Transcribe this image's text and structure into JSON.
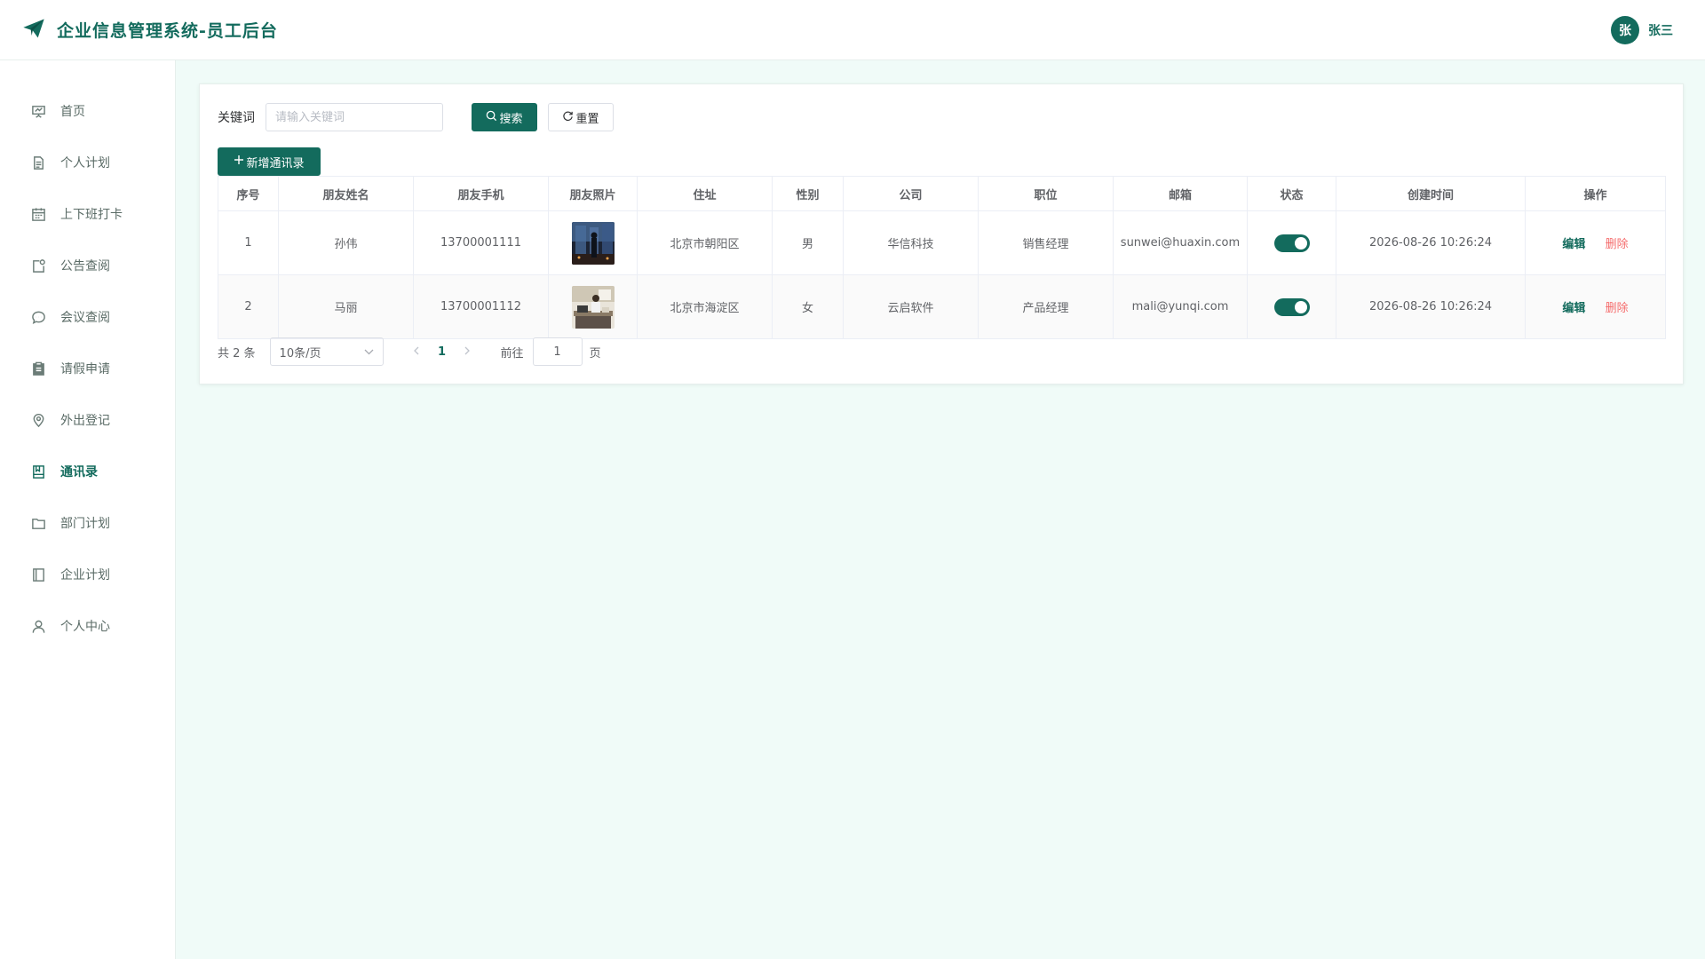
{
  "header": {
    "title": "企业信息管理系统-员工后台",
    "logo_icon": "paper-plane-icon"
  },
  "user": {
    "avatar_text": "张",
    "name": "张三"
  },
  "sidebar": {
    "items": [
      {
        "label": "首页",
        "icon": "presentation-icon"
      },
      {
        "label": "个人计划",
        "icon": "document-icon"
      },
      {
        "label": "上下班打卡",
        "icon": "calendar-icon"
      },
      {
        "label": "公告查阅",
        "icon": "notice-icon"
      },
      {
        "label": "会议查阅",
        "icon": "chat-bubble-icon"
      },
      {
        "label": "请假申请",
        "icon": "clipboard-icon"
      },
      {
        "label": "外出登记",
        "icon": "location-pin-icon"
      },
      {
        "label": "通讯录",
        "icon": "address-book-icon",
        "active": true
      },
      {
        "label": "部门计划",
        "icon": "folder-icon"
      },
      {
        "label": "企业计划",
        "icon": "notebook-icon"
      },
      {
        "label": "个人中心",
        "icon": "user-icon"
      }
    ]
  },
  "search": {
    "keyword_label": "关键词",
    "placeholder": "请输入关键词",
    "value": "",
    "search_label": "搜索",
    "reset_label": "重置",
    "add_label": "新增通讯录"
  },
  "table": {
    "columns": [
      "序号",
      "朋友姓名",
      "朋友手机",
      "朋友照片",
      "住址",
      "性别",
      "公司",
      "职位",
      "邮箱",
      "状态",
      "创建时间",
      "操作"
    ],
    "rows": [
      {
        "index": "1",
        "name": "孙伟",
        "phone": "13700001111",
        "address": "北京市朝阳区",
        "gender": "男",
        "company": "华信科技",
        "position": "销售经理",
        "email": "sunwei@huaxin.com",
        "status_on": true,
        "created": "2026-08-26 10:26:24"
      },
      {
        "index": "2",
        "name": "马丽",
        "phone": "13700001112",
        "address": "北京市海淀区",
        "gender": "女",
        "company": "云启软件",
        "position": "产品经理",
        "email": "mali@yunqi.com",
        "status_on": true,
        "created": "2026-08-26 10:26:24"
      }
    ],
    "edit_label": "编辑",
    "delete_label": "删除"
  },
  "pagination": {
    "total_text": "共 2 条",
    "page_size": "10条/页",
    "current_page": "1",
    "goto_label": "前往",
    "goto_value": "1",
    "page_word": "页"
  },
  "colors": {
    "primary": "#136b5d",
    "danger": "#f56c6c",
    "background": "#f0fbf8"
  }
}
